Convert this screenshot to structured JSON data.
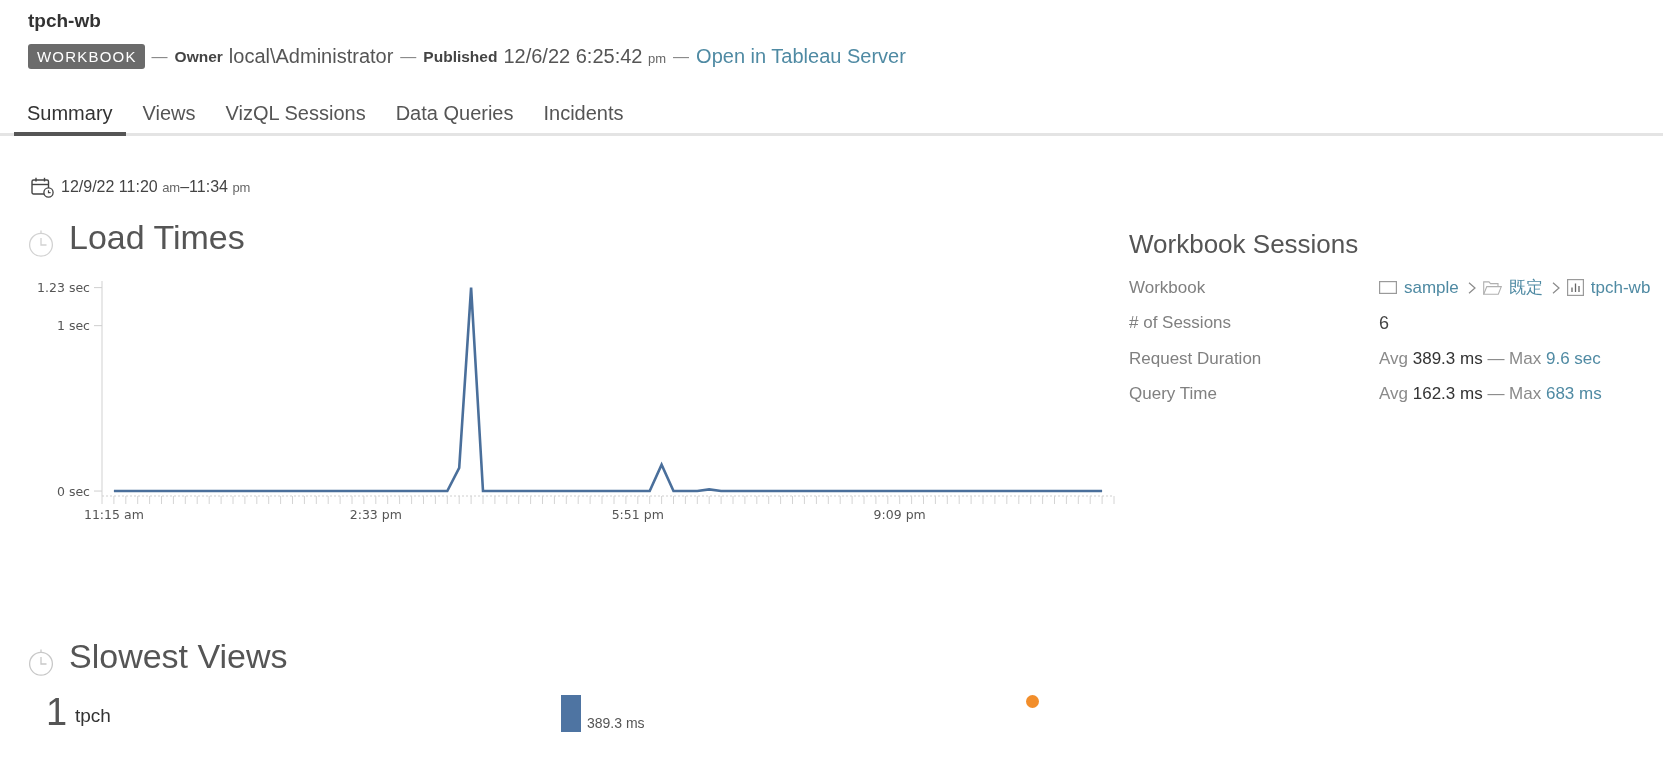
{
  "header": {
    "title": "tpch-wb",
    "meta": [
      {
        "kind": "badge",
        "text": "WORKBOOK"
      },
      {
        "kind": "separator",
        "text": "—"
      },
      {
        "kind": "field",
        "label": "Owner",
        "value": "local\\Administrator"
      },
      {
        "kind": "separator",
        "text": "—"
      },
      {
        "kind": "field",
        "label": "Published",
        "value": "12/6/22 6:25:42",
        "suffix": "pm"
      },
      {
        "kind": "separator",
        "text": "—"
      },
      {
        "kind": "link",
        "text": "Open in Tableau Server"
      }
    ]
  },
  "tabs": [
    {
      "label": "Summary",
      "selected": true
    },
    {
      "label": "Views",
      "selected": false
    },
    {
      "label": "VizQL Sessions",
      "selected": false
    },
    {
      "label": "Data Queries",
      "selected": false
    },
    {
      "label": "Incidents",
      "selected": false
    }
  ],
  "date_range": {
    "start": "12/9/22 11:20",
    "start_suffix": "am",
    "separator": "–",
    "end": "11:34",
    "end_suffix": "pm"
  },
  "load_times": {
    "title": "Load Times",
    "chart_data": {
      "type": "line",
      "x": [
        675,
        927,
        936,
        945,
        954,
        1080,
        1089,
        1098,
        1116,
        1125,
        1134,
        1422
      ],
      "values": [
        0,
        0,
        0.14,
        1.23,
        0,
        0,
        0.16,
        0,
        0,
        0.01,
        0,
        0
      ],
      "xlim": [
        666,
        1431
      ],
      "ylim": [
        -0.03,
        1.27
      ],
      "xticks": [
        {
          "value": 675,
          "label": "11:15 am"
        },
        {
          "value": 873,
          "label": "2:33 pm"
        },
        {
          "value": 1071,
          "label": "5:51 pm"
        },
        {
          "value": 1269,
          "label": "9:09 pm"
        }
      ],
      "yticks": [
        {
          "value": 0,
          "label": "0 sec"
        },
        {
          "value": 1,
          "label": "1 sec"
        },
        {
          "value": 1.23,
          "label": "1.23 sec"
        }
      ]
    }
  },
  "workbook_sessions": {
    "title": "Workbook Sessions",
    "rows": [
      {
        "kind": "breadcrumb",
        "label": "Workbook",
        "items": [
          {
            "kind": "project",
            "text": "sample"
          },
          {
            "kind": "folder",
            "text": "既定"
          },
          {
            "kind": "workbook",
            "text": "tpch-wb"
          }
        ]
      },
      {
        "kind": "value",
        "label": "# of Sessions",
        "value": "6"
      },
      {
        "kind": "stats",
        "label": "Request Duration",
        "avg_label": "Avg",
        "avg": "389.3 ms",
        "separator": "—",
        "max_label": "Max",
        "max": "9.6 sec"
      },
      {
        "kind": "stats",
        "label": "Query Time",
        "avg_label": "Avg",
        "avg": "162.3 ms",
        "separator": "—",
        "max_label": "Max",
        "max": "683 ms"
      }
    ]
  },
  "slowest_views": {
    "title": "Slowest Views",
    "rows": [
      {
        "rank": "1",
        "name": "tpch",
        "duration": "389.3 ms"
      }
    ]
  }
}
